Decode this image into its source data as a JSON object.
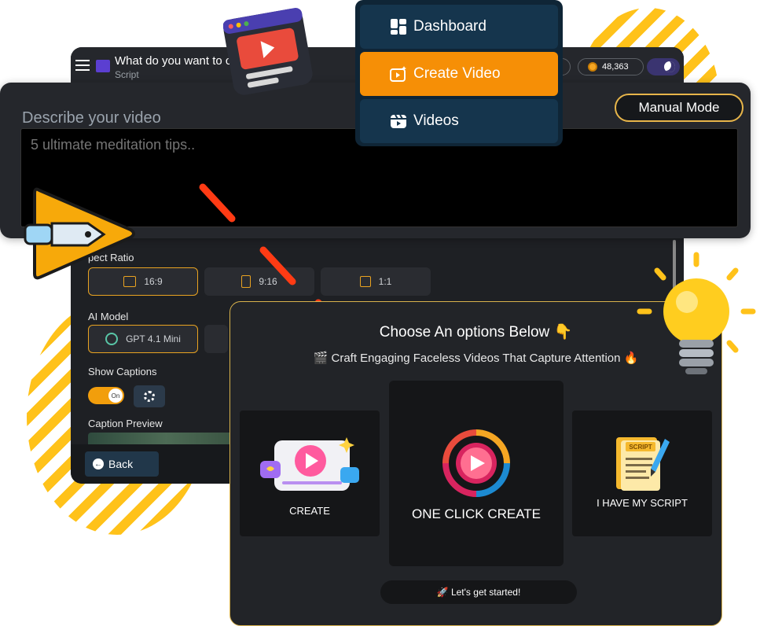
{
  "app": {
    "title": "What do you want to c",
    "subtitle": "Script",
    "credits": "48,363"
  },
  "nav": {
    "items": [
      {
        "label": "Dashboard",
        "icon": "dashboard-icon"
      },
      {
        "label": "Create Video",
        "icon": "create-video-icon",
        "active": true
      },
      {
        "label": "Videos",
        "icon": "videos-icon"
      }
    ]
  },
  "describe": {
    "label": "Describe your video",
    "placeholder": "5 ultimate meditation tips..",
    "manual_mode": "Manual Mode"
  },
  "aspect": {
    "label": "pect Ratio",
    "options": [
      "16:9",
      "9:16",
      "1:1"
    ],
    "selected": "16:9"
  },
  "ai_model": {
    "label": "AI Model",
    "selected": "GPT 4.1 Mini"
  },
  "captions": {
    "label": "Show Captions",
    "toggle": "On",
    "preview_label": "Caption Preview"
  },
  "footer": {
    "back": "Back"
  },
  "choose": {
    "title": "Choose An options Below 👇",
    "subtitle": "🎬 Craft Engaging Faceless Videos That Capture Attention 🔥",
    "options": [
      "CREATE",
      "ONE CLICK CREATE",
      "I HAVE MY SCRIPT"
    ],
    "start": "🚀 Let's get started!",
    "script_sign": "SCRIPT"
  },
  "colors": {
    "accent": "#f68f06",
    "gold_border": "#d8b24c",
    "nav_bg": "#0f2536",
    "panel_bg": "#222428",
    "stripes": "#ffc21a"
  }
}
